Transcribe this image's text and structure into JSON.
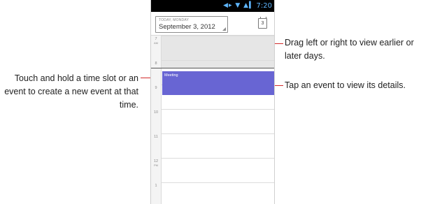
{
  "status_bar": {
    "icons_text": "◀▸ ▼ ▲▍",
    "time": "7:20"
  },
  "header": {
    "today_label": "TODAY, MONDAY",
    "date_label": "September 3, 2012",
    "today_button_label": "3"
  },
  "hours": [
    {
      "hour": "7",
      "ampm": "AM"
    },
    {
      "hour": "8",
      "ampm": ""
    },
    {
      "hour": "9",
      "ampm": ""
    },
    {
      "hour": "10",
      "ampm": ""
    },
    {
      "hour": "11",
      "ampm": ""
    },
    {
      "hour": "12",
      "ampm": "PM"
    },
    {
      "hour": "1",
      "ampm": ""
    }
  ],
  "event": {
    "title": "Meeting",
    "color": "#6865d3"
  },
  "callouts": {
    "drag": "Drag left or right to view earlier or later days.",
    "touch_hold": "Touch and hold a time slot or an event to create a new event at that time.",
    "tap_event": "Tap an event to view its details."
  },
  "colors": {
    "leader_line": "#d22a2a",
    "status_bar_bg": "#000000",
    "past_time_bg": "#e6e6e6"
  }
}
